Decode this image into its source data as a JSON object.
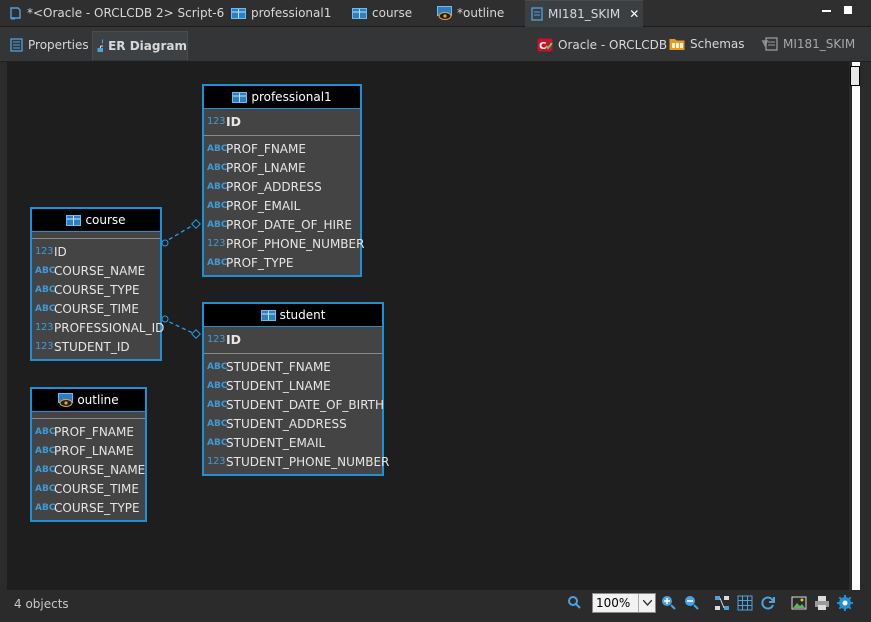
{
  "editor_tabs": [
    {
      "label": "*<Oracle - ORCLCDB 2> Script-6",
      "icon": "sql-script-icon"
    },
    {
      "label": "professional1",
      "icon": "table-icon"
    },
    {
      "label": "course",
      "icon": "table-icon"
    },
    {
      "label": "*outline",
      "icon": "view-icon"
    },
    {
      "label": "MI181_SKIM",
      "icon": "schema-doc-icon",
      "close": "✕"
    }
  ],
  "sub_tabs": [
    {
      "label": "Properties",
      "icon": "properties-icon"
    },
    {
      "label": "ER Diagram",
      "icon": "er-diagram-icon"
    }
  ],
  "breadcrumbs": [
    {
      "label": "Oracle - ORCLCDB",
      "icon": "oracle-connection-icon"
    },
    {
      "label": "Schemas",
      "icon": "schemas-folder-icon"
    },
    {
      "label": "MI181_SKIM",
      "icon": "schema-icon"
    }
  ],
  "entities": {
    "professional1": {
      "title": "professional1",
      "key": [
        {
          "type": "123",
          "name": "ID"
        }
      ],
      "attrs": [
        {
          "type": "ABC",
          "name": "PROF_FNAME"
        },
        {
          "type": "ABC",
          "name": "PROF_LNAME"
        },
        {
          "type": "ABC",
          "name": "PROF_ADDRESS"
        },
        {
          "type": "ABC",
          "name": "PROF_EMAIL"
        },
        {
          "type": "ABC",
          "name": "PROF_DATE_OF_HIRE"
        },
        {
          "type": "123",
          "name": "PROF_PHONE_NUMBER"
        },
        {
          "type": "ABC",
          "name": "PROF_TYPE"
        }
      ]
    },
    "course": {
      "title": "course",
      "key": [],
      "attrs": [
        {
          "type": "123",
          "name": "ID"
        },
        {
          "type": "ABC",
          "name": "COURSE_NAME"
        },
        {
          "type": "ABC",
          "name": "COURSE_TYPE"
        },
        {
          "type": "ABC",
          "name": "COURSE_TIME"
        },
        {
          "type": "123",
          "name": "PROFESSIONAL_ID"
        },
        {
          "type": "123",
          "name": "STUDENT_ID"
        }
      ]
    },
    "student": {
      "title": "student",
      "key": [
        {
          "type": "123",
          "name": "ID"
        }
      ],
      "attrs": [
        {
          "type": "ABC",
          "name": "STUDENT_FNAME"
        },
        {
          "type": "ABC",
          "name": "STUDENT_LNAME"
        },
        {
          "type": "ABC",
          "name": "STUDENT_DATE_OF_BIRTH"
        },
        {
          "type": "ABC",
          "name": "STUDENT_ADDRESS"
        },
        {
          "type": "ABC",
          "name": "STUDENT_EMAIL"
        },
        {
          "type": "123",
          "name": "STUDENT_PHONE_NUMBER"
        }
      ]
    },
    "outline": {
      "title": "outline",
      "key": [],
      "attrs": [
        {
          "type": "ABC",
          "name": "PROF_FNAME"
        },
        {
          "type": "ABC",
          "name": "PROF_LNAME"
        },
        {
          "type": "ABC",
          "name": "COURSE_NAME"
        },
        {
          "type": "ABC",
          "name": "COURSE_TIME"
        },
        {
          "type": "ABC",
          "name": "COURSE_TYPE"
        }
      ]
    }
  },
  "status": {
    "object_count": "4 objects",
    "zoom": "100%"
  },
  "colors": {
    "accent": "#1e90d6",
    "canvas": "#1e1e1e",
    "entity_body": "#444444",
    "type_icon": "#3e9ad6"
  }
}
